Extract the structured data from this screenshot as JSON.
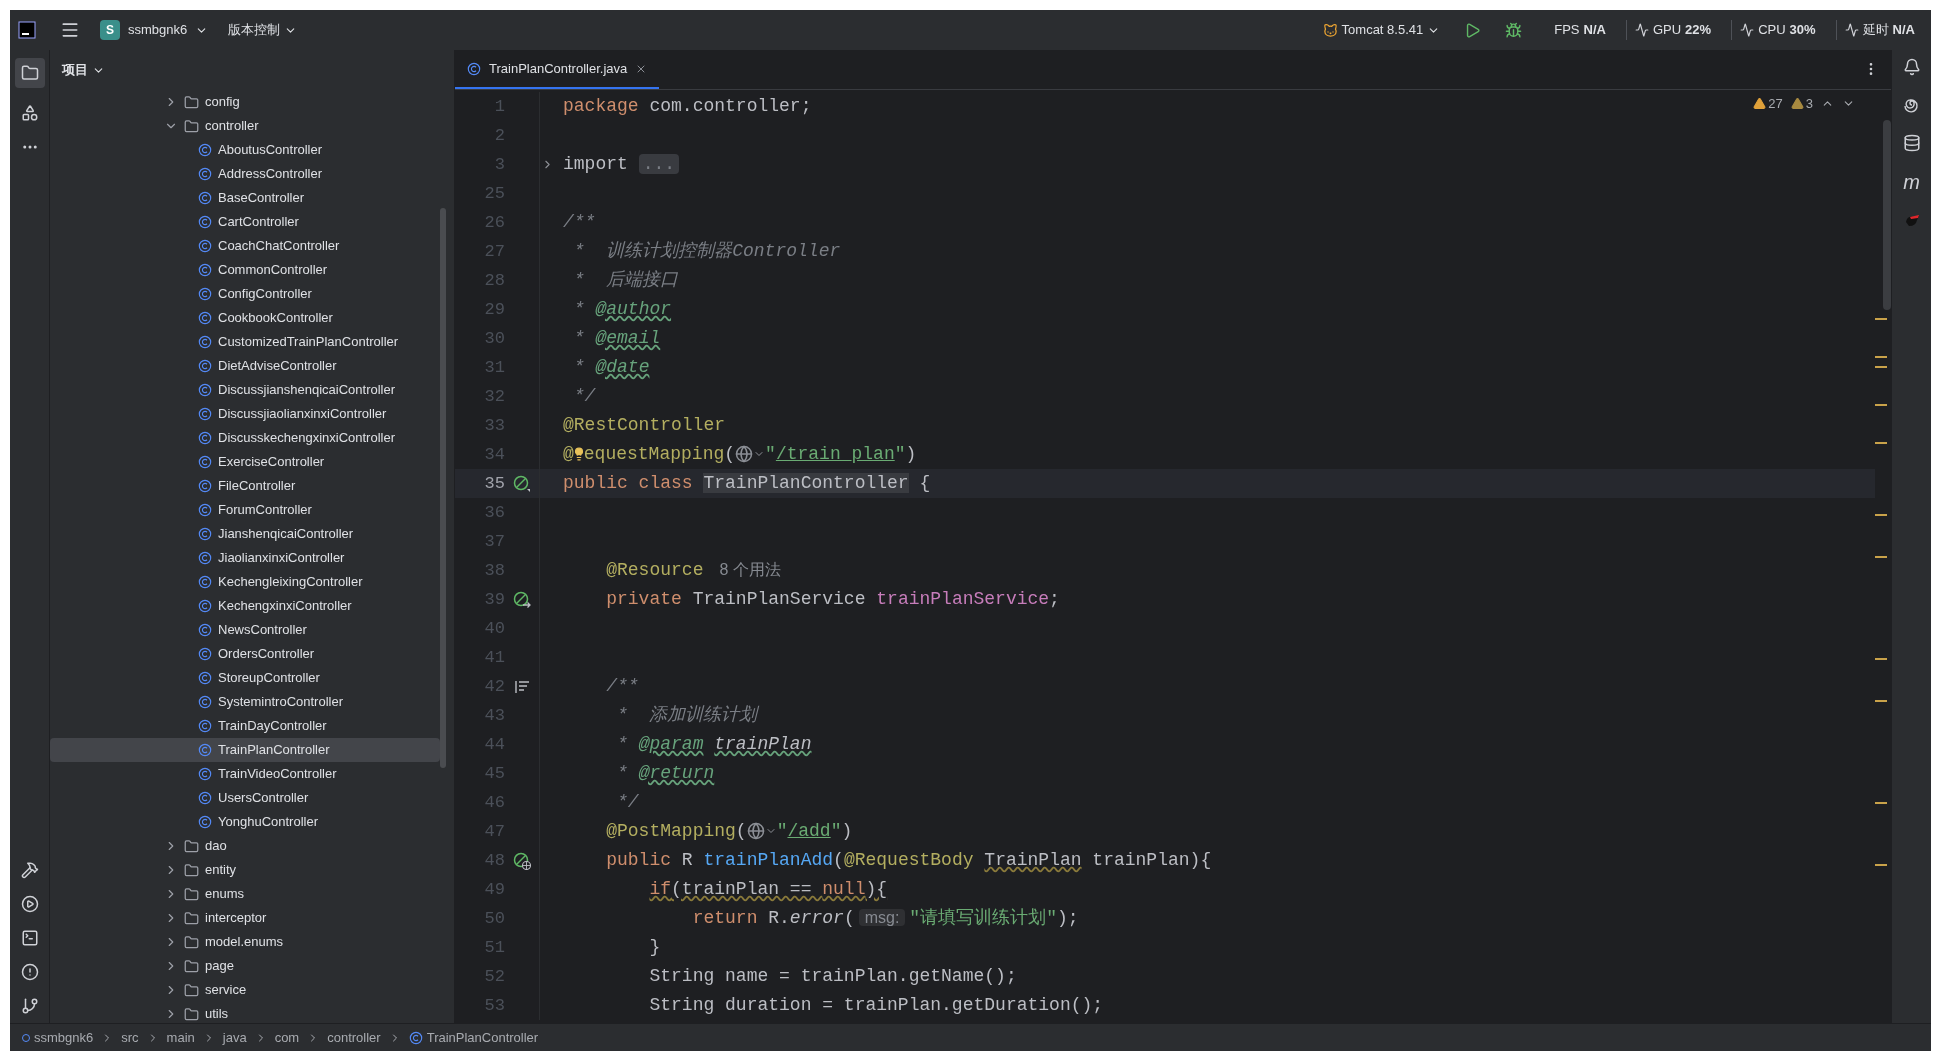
{
  "top_bar": {
    "project_badge": "S",
    "project": "ssmbgnk6",
    "vcs": "版本控制",
    "run_config": "Tomcat 8.5.41",
    "metrics": [
      {
        "kind": "text",
        "label": "FPS",
        "value": "N/A"
      },
      {
        "kind": "gauge",
        "label": "GPU",
        "value": "22%"
      },
      {
        "kind": "gauge",
        "label": "CPU",
        "value": "30%"
      },
      {
        "kind": "gauge",
        "label": "延时",
        "value": "N/A"
      }
    ]
  },
  "project_panel": {
    "title": "项目",
    "tree": [
      {
        "label": "config",
        "kind": "folder",
        "expanded": false,
        "selected": false
      },
      {
        "label": "controller",
        "kind": "folder",
        "expanded": true,
        "selected": false,
        "children": [
          {
            "label": "AboutusController",
            "kind": "class",
            "selected": false
          },
          {
            "label": "AddressController",
            "kind": "class",
            "selected": false
          },
          {
            "label": "BaseController",
            "kind": "class",
            "selected": false
          },
          {
            "label": "CartController",
            "kind": "class",
            "selected": false
          },
          {
            "label": "CoachChatController",
            "kind": "class",
            "selected": false
          },
          {
            "label": "CommonController",
            "kind": "class",
            "selected": false
          },
          {
            "label": "ConfigController",
            "kind": "class",
            "selected": false
          },
          {
            "label": "CookbookController",
            "kind": "class",
            "selected": false
          },
          {
            "label": "CustomizedTrainPlanController",
            "kind": "class",
            "selected": false
          },
          {
            "label": "DietAdviseController",
            "kind": "class",
            "selected": false
          },
          {
            "label": "DiscussjianshenqicaiController",
            "kind": "class",
            "selected": false
          },
          {
            "label": "DiscussjiaolianxinxiController",
            "kind": "class",
            "selected": false
          },
          {
            "label": "DiscusskechengxinxiController",
            "kind": "class",
            "selected": false
          },
          {
            "label": "ExerciseController",
            "kind": "class",
            "selected": false
          },
          {
            "label": "FileController",
            "kind": "class",
            "selected": false
          },
          {
            "label": "ForumController",
            "kind": "class",
            "selected": false
          },
          {
            "label": "JianshenqicaiController",
            "kind": "class",
            "selected": false
          },
          {
            "label": "JiaolianxinxiController",
            "kind": "class",
            "selected": false
          },
          {
            "label": "KechengleixingController",
            "kind": "class",
            "selected": false
          },
          {
            "label": "KechengxinxiController",
            "kind": "class",
            "selected": false
          },
          {
            "label": "NewsController",
            "kind": "class",
            "selected": false
          },
          {
            "label": "OrdersController",
            "kind": "class",
            "selected": false
          },
          {
            "label": "StoreupController",
            "kind": "class",
            "selected": false
          },
          {
            "label": "SystemintroController",
            "kind": "class",
            "selected": false
          },
          {
            "label": "TrainDayController",
            "kind": "class",
            "selected": false
          },
          {
            "label": "TrainPlanController",
            "kind": "class",
            "selected": true
          },
          {
            "label": "TrainVideoController",
            "kind": "class",
            "selected": false
          },
          {
            "label": "UsersController",
            "kind": "class",
            "selected": false
          },
          {
            "label": "YonghuController",
            "kind": "class",
            "selected": false
          }
        ]
      },
      {
        "label": "dao",
        "kind": "folder",
        "expanded": false,
        "selected": false
      },
      {
        "label": "entity",
        "kind": "folder",
        "expanded": false,
        "selected": false
      },
      {
        "label": "enums",
        "kind": "folder",
        "expanded": false,
        "selected": false
      },
      {
        "label": "interceptor",
        "kind": "folder",
        "expanded": false,
        "selected": false
      },
      {
        "label": "model.enums",
        "kind": "folder",
        "expanded": false,
        "selected": false
      },
      {
        "label": "page",
        "kind": "folder",
        "expanded": false,
        "selected": false
      },
      {
        "label": "service",
        "kind": "folder",
        "expanded": false,
        "selected": false
      },
      {
        "label": "utils",
        "kind": "folder",
        "expanded": false,
        "selected": false
      }
    ]
  },
  "editor_tabs": [
    {
      "label": "TrainPlanController.java",
      "selected": true
    }
  ],
  "inspections": [
    {
      "kind": "warning",
      "count": "27"
    },
    {
      "kind": "weak",
      "count": "3"
    }
  ],
  "code": [
    {
      "number": "1",
      "current": false,
      "tokens": [
        {
          "kind": "kw",
          "text": "package"
        },
        {
          "kind": "plain",
          "text": " com.controller;"
        }
      ]
    },
    {
      "number": "2",
      "current": false
    },
    {
      "number": "3",
      "current": false,
      "gutter": {
        "kind": "fold"
      },
      "tokens": [
        {
          "kind": "plain",
          "text": "import "
        },
        {
          "kind": "fold",
          "text": "..."
        }
      ]
    },
    {
      "number": "25",
      "current": false
    },
    {
      "number": "26",
      "current": false,
      "tokens": [
        {
          "kind": "comment",
          "text": "/**"
        }
      ]
    },
    {
      "number": "27",
      "current": false,
      "tokens": [
        {
          "kind": "comment",
          "text": " *  训练计划控制器Controller"
        }
      ]
    },
    {
      "number": "28",
      "current": false,
      "tokens": [
        {
          "kind": "comment",
          "text": " *  后端接口"
        }
      ]
    },
    {
      "number": "29",
      "current": false,
      "tokens": [
        {
          "kind": "comment",
          "text": " * "
        },
        {
          "kind": "doctag",
          "text": "@author"
        }
      ]
    },
    {
      "number": "30",
      "current": false,
      "tokens": [
        {
          "kind": "comment",
          "text": " * "
        },
        {
          "kind": "doctag",
          "text": "@email"
        }
      ]
    },
    {
      "number": "31",
      "current": false,
      "tokens": [
        {
          "kind": "comment",
          "text": " * "
        },
        {
          "kind": "doctag",
          "text": "@date"
        }
      ]
    },
    {
      "number": "32",
      "current": false,
      "tokens": [
        {
          "kind": "comment",
          "text": " */"
        }
      ]
    },
    {
      "number": "33",
      "current": false,
      "tokens": [
        {
          "kind": "ann",
          "text": "@RestController"
        }
      ]
    },
    {
      "number": "34",
      "current": false,
      "tokens": [
        {
          "kind": "ann",
          "text": "@"
        },
        {
          "kind": "bulb"
        },
        {
          "kind": "ann",
          "text": "equestMapping"
        },
        {
          "kind": "plain",
          "text": "("
        },
        {
          "kind": "globe"
        },
        {
          "kind": "str",
          "text": "\""
        },
        {
          "kind": "url",
          "text": "/train_plan"
        },
        {
          "kind": "str",
          "text": "\""
        },
        {
          "kind": "plain",
          "text": ")"
        }
      ]
    },
    {
      "number": "35",
      "current": true,
      "gutter": {
        "kind": "bean"
      },
      "tokens": [
        {
          "kind": "kw",
          "text": "public class "
        },
        {
          "kind": "hl",
          "text": "TrainPlanController"
        },
        {
          "kind": "plain",
          "text": " {"
        }
      ]
    },
    {
      "number": "36",
      "current": false
    },
    {
      "number": "37",
      "current": false
    },
    {
      "number": "38",
      "current": false,
      "tokens": [
        {
          "kind": "ann",
          "text": "    @Resource"
        },
        {
          "kind": "usage",
          "text": "8 个用法"
        }
      ]
    },
    {
      "number": "39",
      "current": false,
      "gutter": {
        "kind": "bean-arrow"
      },
      "tokens": [
        {
          "kind": "kw",
          "text": "    private "
        },
        {
          "kind": "plain",
          "text": "TrainPlanService "
        },
        {
          "kind": "field",
          "text": "trainPlanService"
        },
        {
          "kind": "plain",
          "text": ";"
        }
      ]
    },
    {
      "number": "40",
      "current": false
    },
    {
      "number": "41",
      "current": false
    },
    {
      "number": "42",
      "current": false,
      "gutter": {
        "kind": "doc"
      },
      "tokens": [
        {
          "kind": "comment",
          "text": "    /**"
        }
      ]
    },
    {
      "number": "43",
      "current": false,
      "tokens": [
        {
          "kind": "comment",
          "text": "     *  添加训练计划"
        }
      ]
    },
    {
      "number": "44",
      "current": false,
      "tokens": [
        {
          "kind": "comment",
          "text": "     * "
        },
        {
          "kind": "doctag",
          "text": "@param"
        },
        {
          "kind": "docref",
          "text": " trainPlan"
        }
      ]
    },
    {
      "number": "45",
      "current": false,
      "tokens": [
        {
          "kind": "comment",
          "text": "     * "
        },
        {
          "kind": "doctag",
          "text": "@return"
        }
      ]
    },
    {
      "number": "46",
      "current": false,
      "tokens": [
        {
          "kind": "comment",
          "text": "     */"
        }
      ]
    },
    {
      "number": "47",
      "current": false,
      "tokens": [
        {
          "kind": "ann",
          "text": "    @PostMapping"
        },
        {
          "kind": "plain",
          "text": "("
        },
        {
          "kind": "globe"
        },
        {
          "kind": "str",
          "text": "\""
        },
        {
          "kind": "url",
          "text": "/add"
        },
        {
          "kind": "str",
          "text": "\""
        },
        {
          "kind": "plain",
          "text": ")"
        }
      ]
    },
    {
      "number": "48",
      "current": false,
      "gutter": {
        "kind": "bean-globe"
      },
      "tokens": [
        {
          "kind": "kw",
          "text": "    public "
        },
        {
          "kind": "plain",
          "text": "R "
        },
        {
          "kind": "method",
          "text": "trainPlanAdd"
        },
        {
          "kind": "plain",
          "text": "("
        },
        {
          "kind": "ann",
          "text": "@RequestBody"
        },
        {
          "kind": "warn",
          "text": " TrainPlan"
        },
        {
          "kind": "plain",
          "text": " trainPlan){"
        }
      ]
    },
    {
      "number": "49",
      "current": false,
      "tokens": [
        {
          "kind": "warn-kw",
          "text": "        if"
        },
        {
          "kind": "warn",
          "text": "(trainPlan == "
        },
        {
          "kind": "warn-kw",
          "text": "null"
        },
        {
          "kind": "warn",
          "text": "){"
        }
      ]
    },
    {
      "number": "50",
      "current": false,
      "tokens": [
        {
          "kind": "kw",
          "text": "            return "
        },
        {
          "kind": "plain",
          "text": "R."
        },
        {
          "kind": "static",
          "text": "error"
        },
        {
          "kind": "plain",
          "text": "("
        },
        {
          "kind": "hint",
          "text": "msg:"
        },
        {
          "kind": "str",
          "text": "\"请填写训练计划\""
        },
        {
          "kind": "plain",
          "text": ");"
        }
      ]
    },
    {
      "number": "51",
      "current": false,
      "tokens": [
        {
          "kind": "plain",
          "text": "        }"
        }
      ]
    },
    {
      "number": "52",
      "current": false,
      "tokens": [
        {
          "kind": "plain",
          "text": "        String name = trainPlan.getName();"
        }
      ]
    },
    {
      "number": "53",
      "current": false,
      "tokens": [
        {
          "kind": "plain",
          "text": "        String duration = trainPlan.getDuration();"
        }
      ]
    }
  ],
  "right_toolbar": {
    "maven_label": "m"
  },
  "breadcrumbs": [
    {
      "kind": "module",
      "label": "ssmbgnk6"
    },
    {
      "kind": "folder",
      "label": "src"
    },
    {
      "kind": "folder",
      "label": "main"
    },
    {
      "kind": "folder",
      "label": "java"
    },
    {
      "kind": "folder",
      "label": "com"
    },
    {
      "kind": "folder",
      "label": "controller"
    },
    {
      "kind": "class",
      "label": "TrainPlanController"
    }
  ]
}
